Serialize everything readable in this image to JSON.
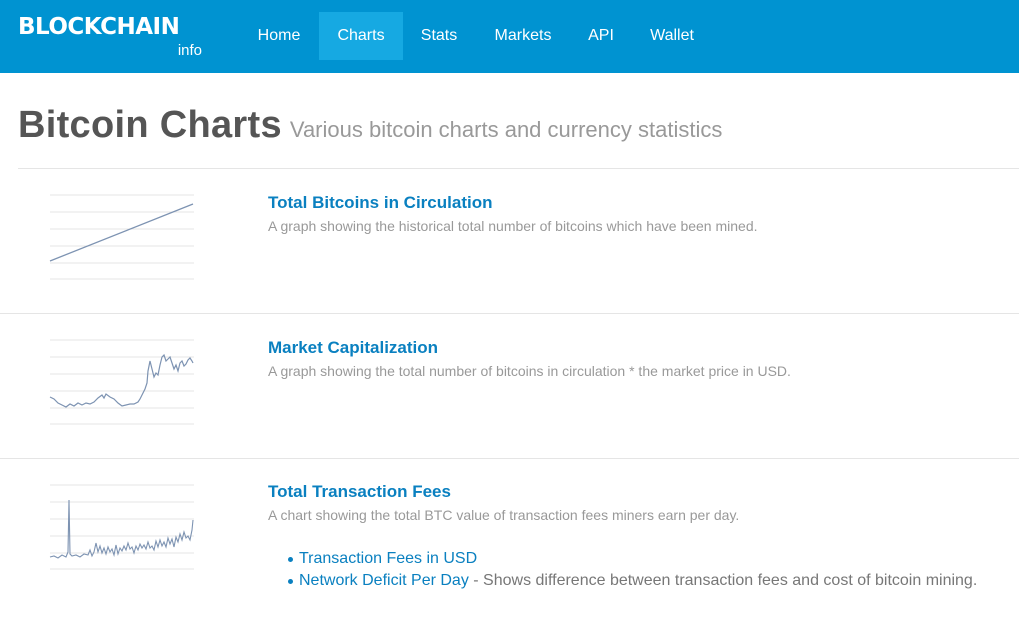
{
  "nav": {
    "logo_main": "BLOCKCHAIN",
    "logo_sub": "info",
    "items": [
      {
        "label": "Home"
      },
      {
        "label": "Charts",
        "active": true
      },
      {
        "label": "Stats"
      },
      {
        "label": "Markets"
      },
      {
        "label": "API"
      },
      {
        "label": "Wallet"
      }
    ]
  },
  "page": {
    "title": "Bitcoin Charts",
    "subtitle": "Various bitcoin charts and currency statistics"
  },
  "charts": [
    {
      "title": "Total Bitcoins in Circulation",
      "description": "A graph showing the historical total number of bitcoins which have been mined."
    },
    {
      "title": "Market Capitalization",
      "description": "A graph showing the total number of bitcoins in circulation * the market price in USD."
    },
    {
      "title": "Total Transaction Fees",
      "description": "A chart showing the total BTC value of transaction fees miners earn per day.",
      "sublinks": [
        {
          "label": "Transaction Fees in USD",
          "tail": ""
        },
        {
          "label": "Network Deficit Per Day",
          "tail": " - Shows difference between transaction fees and cost of bitcoin mining."
        }
      ]
    }
  ],
  "colors": {
    "navbar": "#0093d1",
    "nav_active": "#16a9e2",
    "link": "#0a80c0",
    "thumbnail_line": "#7d93b2"
  }
}
